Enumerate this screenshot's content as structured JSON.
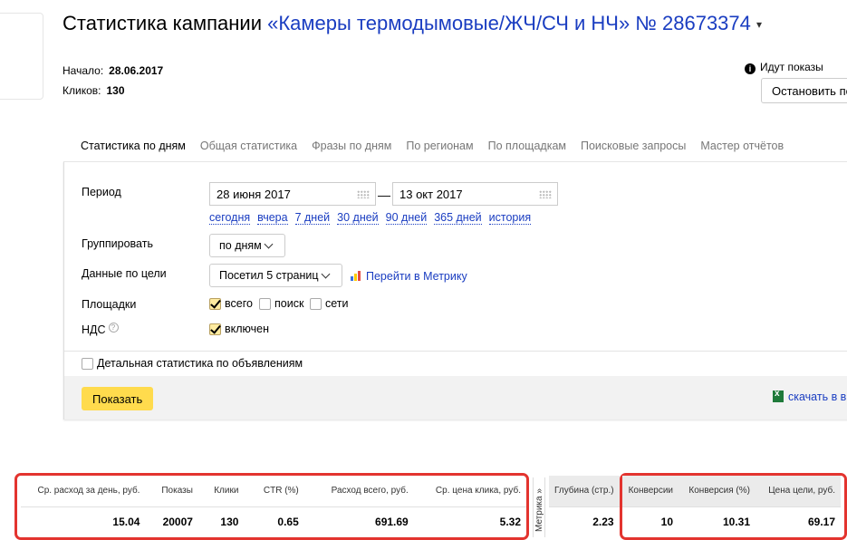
{
  "header": {
    "title_prefix": "Статистика кампании",
    "campaign_name": "«Камеры термодымовые/ЖЧ/СЧ и НЧ» № 28673374",
    "caret": "▾"
  },
  "meta": {
    "start_label": "Начало:",
    "start_value": "28.06.2017",
    "clicks_label": "Кликов:",
    "clicks_value": "130"
  },
  "status": {
    "info_glyph": "i",
    "shows_text": "Идут показы",
    "stop_button": "Остановить по"
  },
  "tabs": [
    {
      "label": "Статистика по дням",
      "active": true
    },
    {
      "label": "Общая статистика",
      "active": false
    },
    {
      "label": "Фразы по дням",
      "active": false
    },
    {
      "label": "По регионам",
      "active": false
    },
    {
      "label": "По площадкам",
      "active": false
    },
    {
      "label": "Поисковые запросы",
      "active": false
    },
    {
      "label": "Мастер отчётов",
      "active": false
    }
  ],
  "filters": {
    "period_label": "Период",
    "date_from": "28 июня 2017",
    "dash": "—",
    "date_to": "13 окт 2017",
    "quick_links": [
      "сегодня",
      "вчера",
      "7 дней",
      "30 дней",
      "90 дней",
      "365 дней",
      "история"
    ],
    "group_label": "Группировать",
    "group_value": "по дням",
    "goal_label": "Данные по цели",
    "goal_value": "Посетил 5 страниц",
    "metrika_link": "Перейти в Метрику",
    "platforms_label": "Площадки",
    "platform_all": "всего",
    "platform_search": "поиск",
    "platform_networks": "сети",
    "vat_label": "НДС",
    "vat_help": "?",
    "vat_option": "включен",
    "detailed_label": "Детальная статистика по объявлениям",
    "show_button": "Показать",
    "download_link": "скачать в в"
  },
  "stats_left": {
    "headers": [
      "Ср. расход за день, руб.",
      "Показы",
      "Клики",
      "CTR (%)",
      "Расход всего, руб.",
      "Ср. цена клика, руб."
    ],
    "values": [
      "15.04",
      "20007",
      "130",
      "0.65",
      "691.69",
      "5.32"
    ]
  },
  "metrika_label": "Метрика »",
  "stats_depth": {
    "header": "Глубина (стр.)",
    "value": "2.23"
  },
  "stats_right": {
    "headers": [
      "Конверсии",
      "Конверсия (%)",
      "Цена цели, руб."
    ],
    "values": [
      "10",
      "10.31",
      "69.17"
    ]
  },
  "colors": {
    "link": "#1a3dc1",
    "highlight_box": "#e3342f",
    "primary_button": "#ffdb4d",
    "active_tab_underline": "#e53030"
  }
}
